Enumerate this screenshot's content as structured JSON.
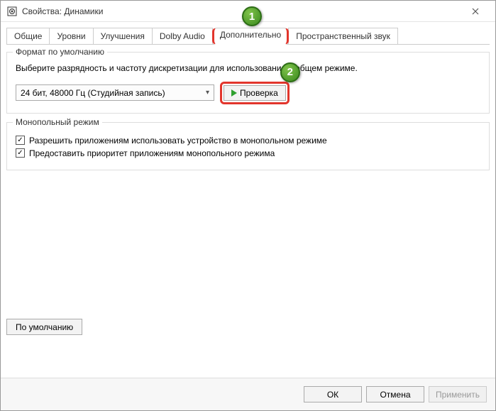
{
  "window": {
    "title": "Свойства: Динамики"
  },
  "tabs": {
    "t0": "Общие",
    "t1": "Уровни",
    "t2": "Улучшения",
    "t3": "Dolby Audio",
    "t4": "Дополнительно",
    "t5": "Пространственный звук"
  },
  "group_default_format": {
    "title": "Формат по умолчанию",
    "description": "Выберите разрядность и частоту дискретизации для использования в общем режиме.",
    "combo_value": "24 бит, 48000 Гц (Студийная запись)",
    "test_button": "Проверка"
  },
  "group_exclusive": {
    "title": "Монопольный режим",
    "check1": "Разрешить приложениям использовать устройство в монопольном режиме",
    "check2": "Предоставить приоритет приложениям монопольного режима"
  },
  "defaults_button": "По умолчанию",
  "footer": {
    "ok": "ОК",
    "cancel": "Отмена",
    "apply": "Применить"
  },
  "callouts": {
    "c1": "1",
    "c2": "2"
  }
}
